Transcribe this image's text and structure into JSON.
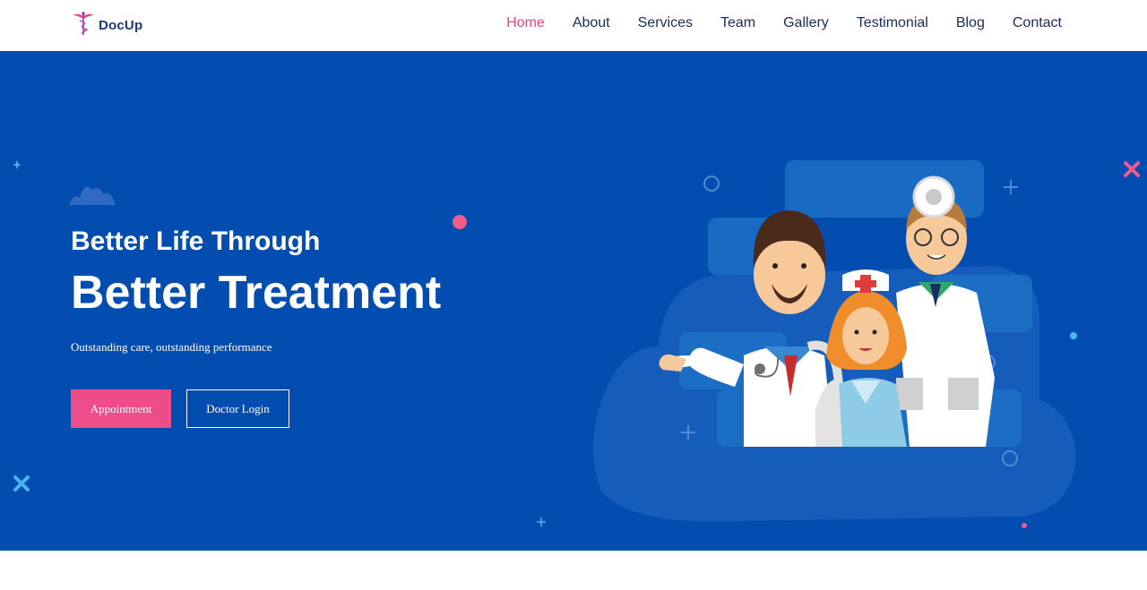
{
  "brand": {
    "name": "DocUp",
    "logo_icon": "caduceus-icon",
    "accent_color": "#e4457a",
    "logo_color": "#1b3a7a"
  },
  "nav": {
    "items": [
      {
        "label": "Home",
        "active": true
      },
      {
        "label": "About",
        "active": false
      },
      {
        "label": "Services",
        "active": false
      },
      {
        "label": "Team",
        "active": false
      },
      {
        "label": "Gallery",
        "active": false
      },
      {
        "label": "Testimonial",
        "active": false
      },
      {
        "label": "Blog",
        "active": false
      },
      {
        "label": "Contact",
        "active": false
      }
    ],
    "text_color": "#1a2b5a"
  },
  "hero": {
    "background_color": "#044db0",
    "eyebrow": "Better Life Through",
    "headline": "Better Treatment",
    "tagline": "Outstanding care, outstanding performance",
    "buttons": {
      "appointment_label": "Appointment",
      "appointment_color": "#ef4d8a",
      "login_label": "Doctor Login"
    },
    "illustration_icon": "medical-team-illustration"
  }
}
